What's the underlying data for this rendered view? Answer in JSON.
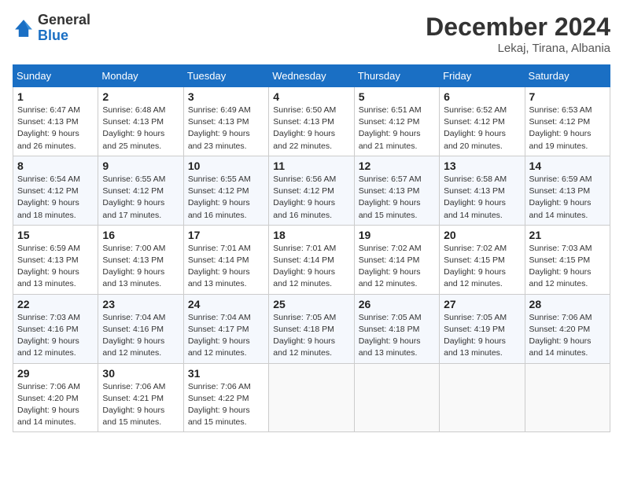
{
  "header": {
    "logo_general": "General",
    "logo_blue": "Blue",
    "month_title": "December 2024",
    "location": "Lekaj, Tirana, Albania"
  },
  "weekdays": [
    "Sunday",
    "Monday",
    "Tuesday",
    "Wednesday",
    "Thursday",
    "Friday",
    "Saturday"
  ],
  "weeks": [
    [
      {
        "day": "1",
        "sunrise": "Sunrise: 6:47 AM",
        "sunset": "Sunset: 4:13 PM",
        "daylight": "Daylight: 9 hours and 26 minutes."
      },
      {
        "day": "2",
        "sunrise": "Sunrise: 6:48 AM",
        "sunset": "Sunset: 4:13 PM",
        "daylight": "Daylight: 9 hours and 25 minutes."
      },
      {
        "day": "3",
        "sunrise": "Sunrise: 6:49 AM",
        "sunset": "Sunset: 4:13 PM",
        "daylight": "Daylight: 9 hours and 23 minutes."
      },
      {
        "day": "4",
        "sunrise": "Sunrise: 6:50 AM",
        "sunset": "Sunset: 4:13 PM",
        "daylight": "Daylight: 9 hours and 22 minutes."
      },
      {
        "day": "5",
        "sunrise": "Sunrise: 6:51 AM",
        "sunset": "Sunset: 4:12 PM",
        "daylight": "Daylight: 9 hours and 21 minutes."
      },
      {
        "day": "6",
        "sunrise": "Sunrise: 6:52 AM",
        "sunset": "Sunset: 4:12 PM",
        "daylight": "Daylight: 9 hours and 20 minutes."
      },
      {
        "day": "7",
        "sunrise": "Sunrise: 6:53 AM",
        "sunset": "Sunset: 4:12 PM",
        "daylight": "Daylight: 9 hours and 19 minutes."
      }
    ],
    [
      {
        "day": "8",
        "sunrise": "Sunrise: 6:54 AM",
        "sunset": "Sunset: 4:12 PM",
        "daylight": "Daylight: 9 hours and 18 minutes."
      },
      {
        "day": "9",
        "sunrise": "Sunrise: 6:55 AM",
        "sunset": "Sunset: 4:12 PM",
        "daylight": "Daylight: 9 hours and 17 minutes."
      },
      {
        "day": "10",
        "sunrise": "Sunrise: 6:55 AM",
        "sunset": "Sunset: 4:12 PM",
        "daylight": "Daylight: 9 hours and 16 minutes."
      },
      {
        "day": "11",
        "sunrise": "Sunrise: 6:56 AM",
        "sunset": "Sunset: 4:12 PM",
        "daylight": "Daylight: 9 hours and 16 minutes."
      },
      {
        "day": "12",
        "sunrise": "Sunrise: 6:57 AM",
        "sunset": "Sunset: 4:13 PM",
        "daylight": "Daylight: 9 hours and 15 minutes."
      },
      {
        "day": "13",
        "sunrise": "Sunrise: 6:58 AM",
        "sunset": "Sunset: 4:13 PM",
        "daylight": "Daylight: 9 hours and 14 minutes."
      },
      {
        "day": "14",
        "sunrise": "Sunrise: 6:59 AM",
        "sunset": "Sunset: 4:13 PM",
        "daylight": "Daylight: 9 hours and 14 minutes."
      }
    ],
    [
      {
        "day": "15",
        "sunrise": "Sunrise: 6:59 AM",
        "sunset": "Sunset: 4:13 PM",
        "daylight": "Daylight: 9 hours and 13 minutes."
      },
      {
        "day": "16",
        "sunrise": "Sunrise: 7:00 AM",
        "sunset": "Sunset: 4:13 PM",
        "daylight": "Daylight: 9 hours and 13 minutes."
      },
      {
        "day": "17",
        "sunrise": "Sunrise: 7:01 AM",
        "sunset": "Sunset: 4:14 PM",
        "daylight": "Daylight: 9 hours and 13 minutes."
      },
      {
        "day": "18",
        "sunrise": "Sunrise: 7:01 AM",
        "sunset": "Sunset: 4:14 PM",
        "daylight": "Daylight: 9 hours and 12 minutes."
      },
      {
        "day": "19",
        "sunrise": "Sunrise: 7:02 AM",
        "sunset": "Sunset: 4:14 PM",
        "daylight": "Daylight: 9 hours and 12 minutes."
      },
      {
        "day": "20",
        "sunrise": "Sunrise: 7:02 AM",
        "sunset": "Sunset: 4:15 PM",
        "daylight": "Daylight: 9 hours and 12 minutes."
      },
      {
        "day": "21",
        "sunrise": "Sunrise: 7:03 AM",
        "sunset": "Sunset: 4:15 PM",
        "daylight": "Daylight: 9 hours and 12 minutes."
      }
    ],
    [
      {
        "day": "22",
        "sunrise": "Sunrise: 7:03 AM",
        "sunset": "Sunset: 4:16 PM",
        "daylight": "Daylight: 9 hours and 12 minutes."
      },
      {
        "day": "23",
        "sunrise": "Sunrise: 7:04 AM",
        "sunset": "Sunset: 4:16 PM",
        "daylight": "Daylight: 9 hours and 12 minutes."
      },
      {
        "day": "24",
        "sunrise": "Sunrise: 7:04 AM",
        "sunset": "Sunset: 4:17 PM",
        "daylight": "Daylight: 9 hours and 12 minutes."
      },
      {
        "day": "25",
        "sunrise": "Sunrise: 7:05 AM",
        "sunset": "Sunset: 4:18 PM",
        "daylight": "Daylight: 9 hours and 12 minutes."
      },
      {
        "day": "26",
        "sunrise": "Sunrise: 7:05 AM",
        "sunset": "Sunset: 4:18 PM",
        "daylight": "Daylight: 9 hours and 13 minutes."
      },
      {
        "day": "27",
        "sunrise": "Sunrise: 7:05 AM",
        "sunset": "Sunset: 4:19 PM",
        "daylight": "Daylight: 9 hours and 13 minutes."
      },
      {
        "day": "28",
        "sunrise": "Sunrise: 7:06 AM",
        "sunset": "Sunset: 4:20 PM",
        "daylight": "Daylight: 9 hours and 14 minutes."
      }
    ],
    [
      {
        "day": "29",
        "sunrise": "Sunrise: 7:06 AM",
        "sunset": "Sunset: 4:20 PM",
        "daylight": "Daylight: 9 hours and 14 minutes."
      },
      {
        "day": "30",
        "sunrise": "Sunrise: 7:06 AM",
        "sunset": "Sunset: 4:21 PM",
        "daylight": "Daylight: 9 hours and 15 minutes."
      },
      {
        "day": "31",
        "sunrise": "Sunrise: 7:06 AM",
        "sunset": "Sunset: 4:22 PM",
        "daylight": "Daylight: 9 hours and 15 minutes."
      },
      null,
      null,
      null,
      null
    ]
  ]
}
